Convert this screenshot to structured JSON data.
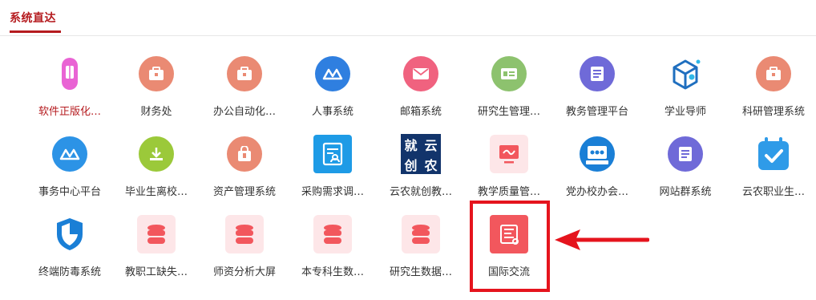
{
  "header": {
    "title": "系统直达"
  },
  "colors": {
    "accent": "#b51b1f",
    "salmon": "#ea8a73",
    "blue": "#2f7fe0",
    "pink": "#f0627f",
    "green": "#8dc26e",
    "purple": "#6f6ad8",
    "lime": "#9bc93a",
    "teal_blue": "#2c93e6",
    "db_red": "#f2575d",
    "highlight": "#e5141d"
  },
  "tiles": [
    {
      "label": "软件正版化…",
      "icon": "book-icon",
      "active": true
    },
    {
      "label": "财务处",
      "icon": "briefcase-icon"
    },
    {
      "label": "办公自动化…",
      "icon": "briefcase-icon"
    },
    {
      "label": "人事系统",
      "icon": "people-icon"
    },
    {
      "label": "邮箱系统",
      "icon": "mail-icon"
    },
    {
      "label": "研究生管理…",
      "icon": "id-card-icon"
    },
    {
      "label": "教务管理平台",
      "icon": "document-icon"
    },
    {
      "label": "学业导师",
      "icon": "cube-icon"
    },
    {
      "label": "科研管理系统",
      "icon": "briefcase-icon"
    },
    {
      "label": "事务中心平台",
      "icon": "people-icon"
    },
    {
      "label": "毕业生离校…",
      "icon": "download-icon"
    },
    {
      "label": "资产管理系统",
      "icon": "bag-icon"
    },
    {
      "label": "采购需求调…",
      "icon": "form-icon"
    },
    {
      "label": "云农就创教…",
      "icon": "calligraphy-logo",
      "logo_text": [
        "就",
        "云",
        "创",
        "农"
      ]
    },
    {
      "label": "教学质量管…",
      "icon": "monitor-icon"
    },
    {
      "label": "党办校办会…",
      "icon": "meeting-icon"
    },
    {
      "label": "网站群系统",
      "icon": "document-icon"
    },
    {
      "label": "云农职业生…",
      "icon": "calendar-check-icon"
    },
    {
      "label": "终端防毒系统",
      "icon": "shield-icon"
    },
    {
      "label": "教职工缺失…",
      "icon": "database-icon"
    },
    {
      "label": "师资分析大屏",
      "icon": "database-icon"
    },
    {
      "label": "本专科生数…",
      "icon": "database-icon"
    },
    {
      "label": "研究生数据…",
      "icon": "database-icon"
    },
    {
      "label": "国际交流",
      "icon": "scroll-icon"
    }
  ]
}
